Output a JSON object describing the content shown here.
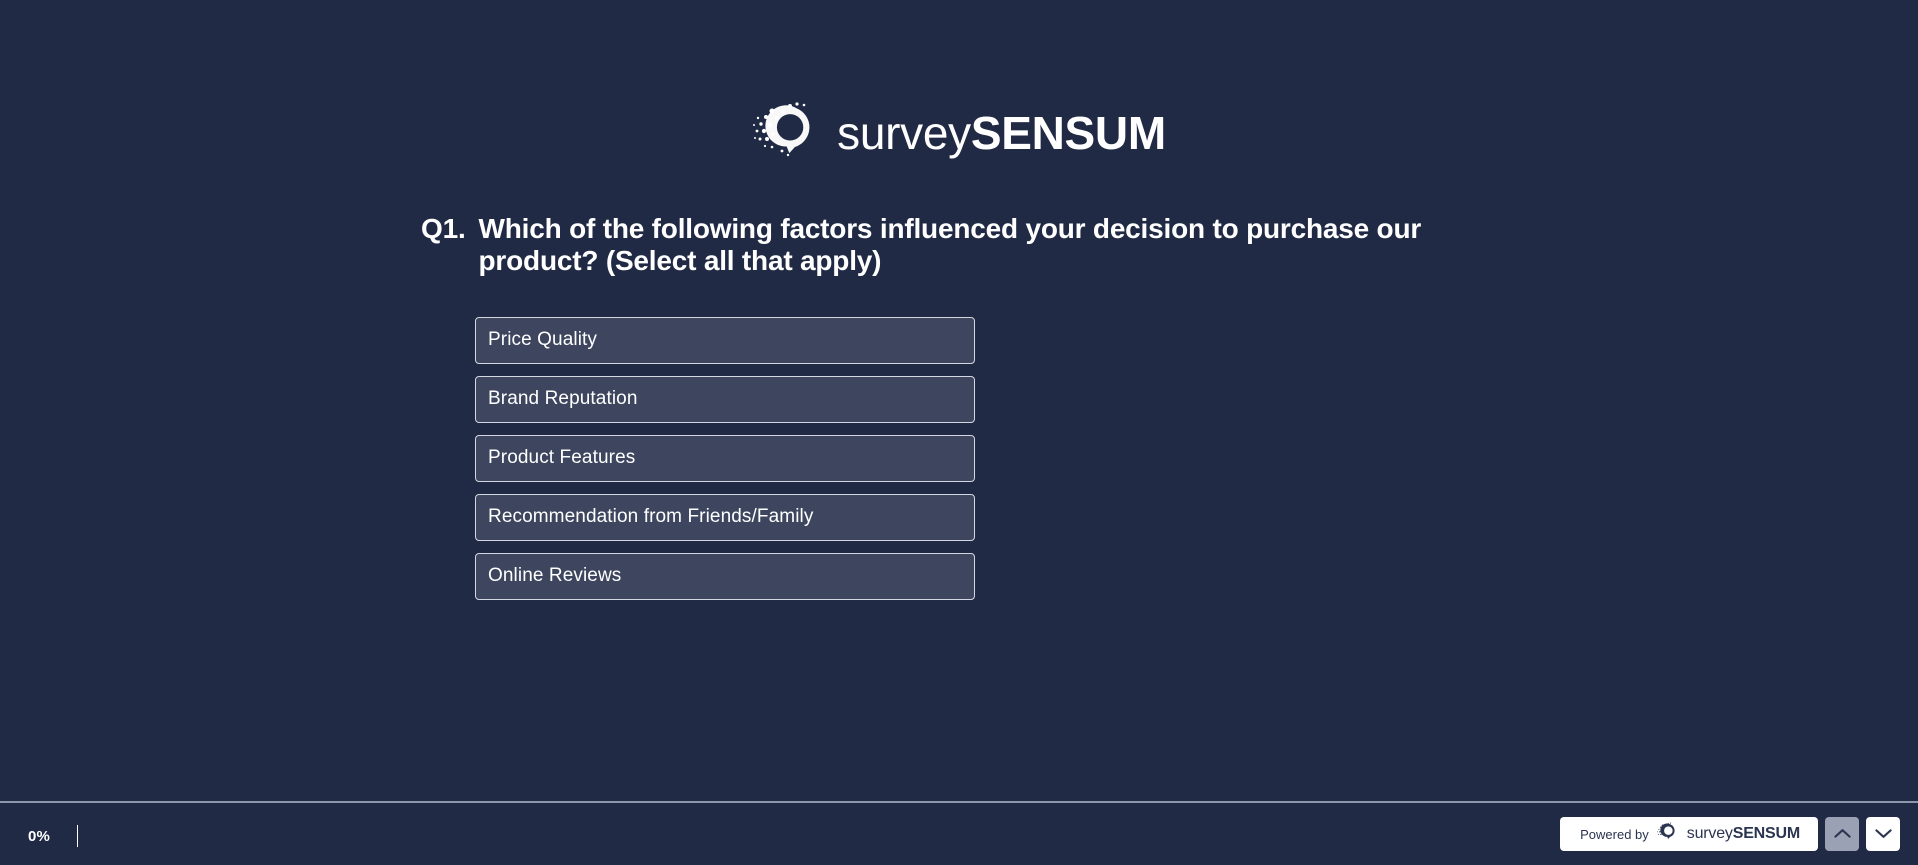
{
  "brand": {
    "logo_icon": "surveysensum-q-logo-icon",
    "name_light": "survey",
    "name_bold": "SENSUM"
  },
  "question": {
    "number": "Q1.",
    "text": "Which of the following factors influenced your decision to purchase our product? (Select all that apply)",
    "options": [
      {
        "label": "Price Quality"
      },
      {
        "label": "Brand Reputation"
      },
      {
        "label": "Product Features"
      },
      {
        "label": "Recommendation from Friends/Family"
      },
      {
        "label": "Online Reviews"
      }
    ]
  },
  "footer": {
    "progress_percent": "0%",
    "powered_by_label": "Powered by",
    "powered_logo_icon": "surveysensum-q-logo-icon",
    "powered_name_light": "survey",
    "powered_name_bold": "SENSUM",
    "prev_icon": "chevron-up-icon",
    "next_icon": "chevron-down-icon"
  },
  "colors": {
    "background": "#212a45",
    "option_fill": "#3d465e",
    "option_border": "#d4d8e2",
    "divider": "#8e97ac",
    "badge_bg": "#ffffff",
    "nav_disabled": "#9aa1b4",
    "text": "#ffffff"
  }
}
